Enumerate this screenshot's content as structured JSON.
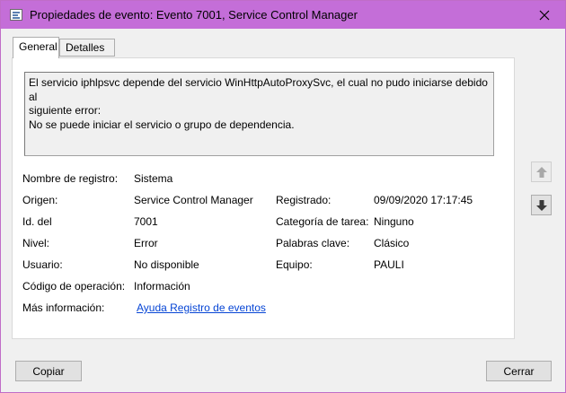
{
  "window": {
    "title": "Propiedades de evento: Evento 7001, Service Control Manager",
    "icons": {
      "app": "event-log-icon",
      "close": "close-icon"
    }
  },
  "tabs": [
    {
      "label": "General",
      "selected": true
    },
    {
      "label": "Detalles",
      "selected": false
    }
  ],
  "description": {
    "lines": [
      "El servicio iphlpsvc depende del servicio WinHttpAutoProxySvc, el cual no pudo iniciarse debido al",
      "siguiente error:",
      "No se puede iniciar el servicio o grupo de dependencia."
    ]
  },
  "fields": {
    "log_name": {
      "label": "Nombre de registro:",
      "value": "Sistema"
    },
    "source": {
      "label": "Origen:",
      "value": "Service Control Manager"
    },
    "logged": {
      "label": "Registrado:",
      "value": "09/09/2020 17:17:45"
    },
    "event_id": {
      "label": "Id. del",
      "value": "7001"
    },
    "task_category": {
      "label": "Categoría de tarea:",
      "value": "Ninguno"
    },
    "level": {
      "label": "Nivel:",
      "value": "Error"
    },
    "keywords": {
      "label": "Palabras clave:",
      "value": "Clásico"
    },
    "user": {
      "label": "Usuario:",
      "value": "No disponible"
    },
    "computer": {
      "label": "Equipo:",
      "value": "PAULI"
    },
    "opcode": {
      "label": "Código de operación:",
      "value": "Información"
    },
    "more_info": {
      "label": "Más información:",
      "link": "Ayuda Registro de eventos"
    }
  },
  "nav": {
    "up_icon": "arrow-up-icon",
    "down_icon": "arrow-down-icon"
  },
  "buttons": {
    "copy": "Copiar",
    "close": "Cerrar"
  },
  "colors": {
    "titlebar": "#c46ed8",
    "link": "#0645d5",
    "dialog_bg": "#f0f0f0"
  }
}
